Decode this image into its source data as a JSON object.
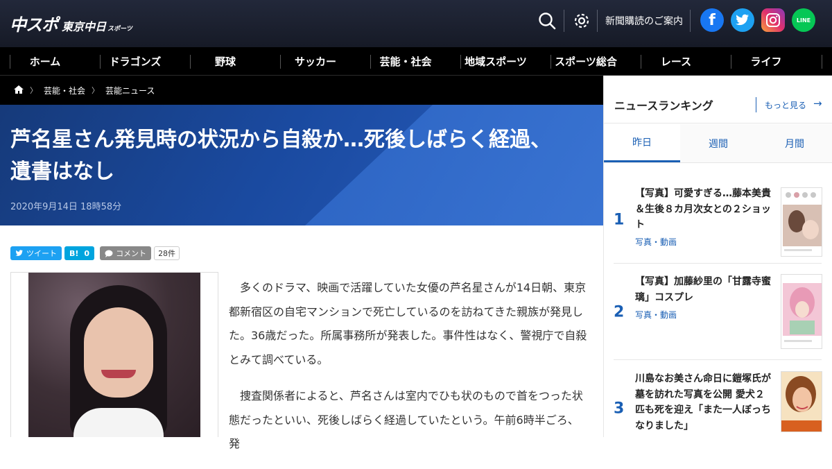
{
  "logo": {
    "brand": "中スポ",
    "name": "東京中日",
    "sub": "スポーツ"
  },
  "header": {
    "subscribe_label": "新聞購読のご案内",
    "sns": {
      "facebook": "f",
      "line": "LINE"
    }
  },
  "nav": [
    "ホーム",
    "ドラゴンズ",
    "野球",
    "サッカー",
    "芸能・社会",
    "地域スポーツ",
    "スポーツ総合",
    "レース",
    "ライフ"
  ],
  "breadcrumb": {
    "items": [
      "芸能・社会",
      "芸能ニュース"
    ]
  },
  "article": {
    "title": "芦名星さん発見時の状況から自殺か…死後しばらく経過、遺書はなし",
    "date": "2020年9月14日 18時58分",
    "share": {
      "tweet": "ツイート",
      "hatena": "B!",
      "hatena_count": "0",
      "comment": "コメント",
      "comment_count": "28件"
    },
    "paragraphs": [
      "多くのドラマ、映画で活躍していた女優の芦名星さんが14日朝、東京都新宿区の自宅マンションで死亡しているのを訪ねてきた親族が発見した。36歳だった。所属事務所が発表した。事件性はなく、警視庁で自殺とみて調べている。",
      "捜査関係者によると、芦名さんは室内でひも状のもので首をつった状態だったといい、死後しばらく経過していたという。午前6時半ごろ、発"
    ]
  },
  "sidebar": {
    "title": "ニュースランキング",
    "more": "もっと見る",
    "tabs": [
      "昨日",
      "週間",
      "月間"
    ],
    "ranking": [
      {
        "rank": "1",
        "title": "【写真】可愛すぎる…藤本美貴＆生後８カ月次女との２ショット",
        "category": "写真・動画"
      },
      {
        "rank": "2",
        "title": "【写真】加藤紗里の「甘露寺蜜璃」コスプレ",
        "category": "写真・動画"
      },
      {
        "rank": "3",
        "title": "川島なお美さん命日に鎧塚氏が墓を訪れた写真を公開 愛犬２匹も死を迎え「また一人ぼっちなりました」",
        "category": ""
      }
    ]
  },
  "colors": {
    "header_bg": "#1b2030",
    "accent": "#1a5fb4",
    "twitter": "#1da1f2",
    "hatena": "#00a4de",
    "comment": "#888888",
    "facebook": "#1877f2",
    "line": "#06c755"
  }
}
